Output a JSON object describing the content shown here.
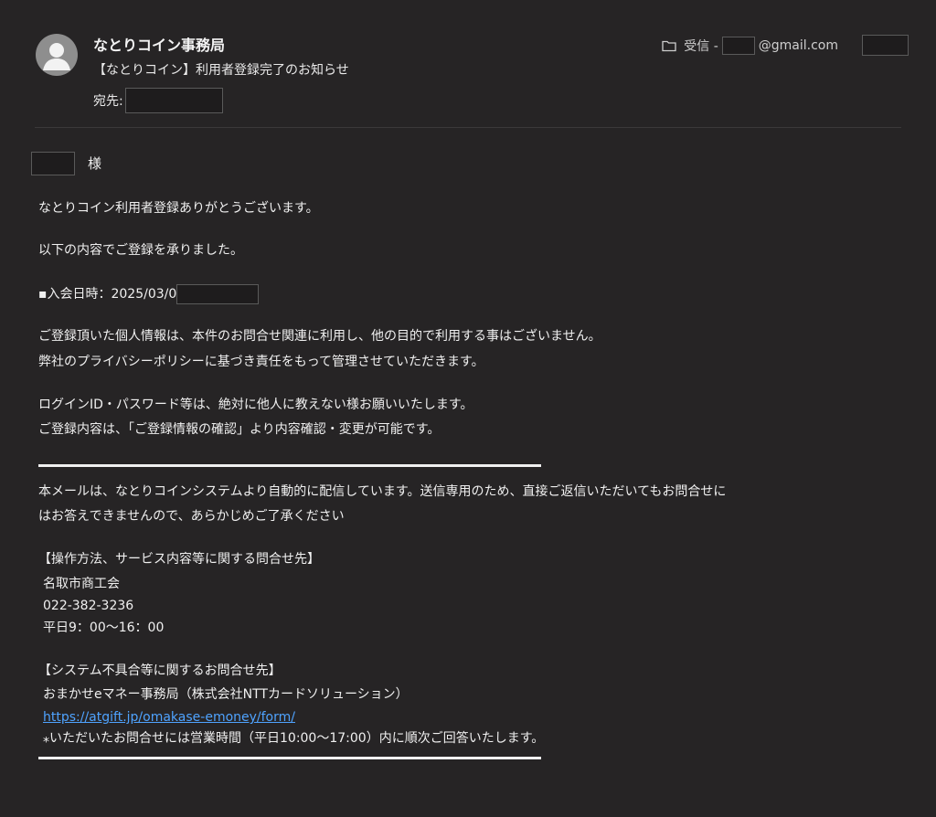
{
  "header": {
    "sender_name": "なとりコイン事務局",
    "subject": "【なとりコイン】利用者登録完了のお知らせ",
    "to_label": "宛先:",
    "mailbox_prefix": "受信 -",
    "mailbox_suffix": "@gmail.com"
  },
  "body": {
    "greeting_suffix": "様",
    "thanks": "なとりコイン利用者登録ありがとうございます。",
    "registered": "以下の内容でご登録を承りました。",
    "join_date_label": "▪入会日時：2025/03/0",
    "privacy_1": "ご登録頂いた個人情報は、本件のお問合せ関連に利用し、他の目的で利用する事はございません。",
    "privacy_2": "弊社のプライバシーポリシーに基づき責任をもって管理させていただきます。",
    "login_1": "ログインID・パスワード等は、絶対に他人に教えない様お願いいたします。",
    "login_2": "ご登録内容は、「ご登録情報の確認」より内容確認・変更が可能です。",
    "auto_1": "本メールは、なとりコインシステムより自動的に配信しています。送信専用のため、直接ご返信いただいてもお問合せに",
    "auto_2": "はお答えできませんので、あらかじめご了承ください",
    "contact1_title": "【操作方法、サービス内容等に関する問合せ先】",
    "contact1_name": "名取市商工会",
    "contact1_phone": "022-382-3236",
    "contact1_hours": "平日9：00〜16：00",
    "contact2_title": "【システム不具合等に関するお問合せ先】",
    "contact2_name": "おまかせeマネー事務局（株式会社NTTカードソリューション）",
    "contact2_url": "https://atgift.jp/omakase-emoney/form/",
    "contact2_note": "⁎いただいたお問合せには営業時間（平日10:00〜17:00）内に順次ご回答いたします。"
  },
  "colors": {
    "background": "#262425",
    "text": "#f0f0f0",
    "link": "#4fa3ff",
    "avatar": "#8e8e8e"
  }
}
